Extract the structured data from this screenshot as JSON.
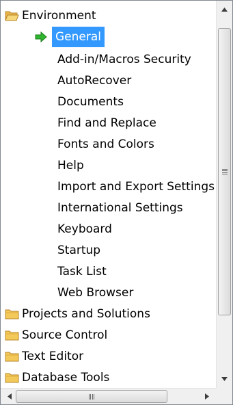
{
  "tree": {
    "nodes": [
      {
        "label": "Environment",
        "icon": "open-folder-icon",
        "level": 0
      },
      {
        "label": "General",
        "icon": "green-arrow-icon",
        "level": 1,
        "selected": true
      },
      {
        "label": "Add-in/Macros Security",
        "level": 1
      },
      {
        "label": "AutoRecover",
        "level": 1
      },
      {
        "label": "Documents",
        "level": 1
      },
      {
        "label": "Find and Replace",
        "level": 1
      },
      {
        "label": "Fonts and Colors",
        "level": 1
      },
      {
        "label": "Help",
        "level": 1
      },
      {
        "label": "Import and Export Settings",
        "level": 1
      },
      {
        "label": "International Settings",
        "level": 1
      },
      {
        "label": "Keyboard",
        "level": 1
      },
      {
        "label": "Startup",
        "level": 1
      },
      {
        "label": "Task List",
        "level": 1
      },
      {
        "label": "Web Browser",
        "level": 1
      },
      {
        "label": "Projects and Solutions",
        "icon": "folder-icon",
        "level": 0
      },
      {
        "label": "Source Control",
        "icon": "folder-icon",
        "level": 0
      },
      {
        "label": "Text Editor",
        "icon": "folder-icon",
        "level": 0
      },
      {
        "label": "Database Tools",
        "icon": "folder-icon",
        "level": 0
      }
    ]
  },
  "colors": {
    "selection": "#3399ff",
    "folder": "#f3c95a",
    "arrow": "#2fb52f",
    "border": "#828790"
  }
}
